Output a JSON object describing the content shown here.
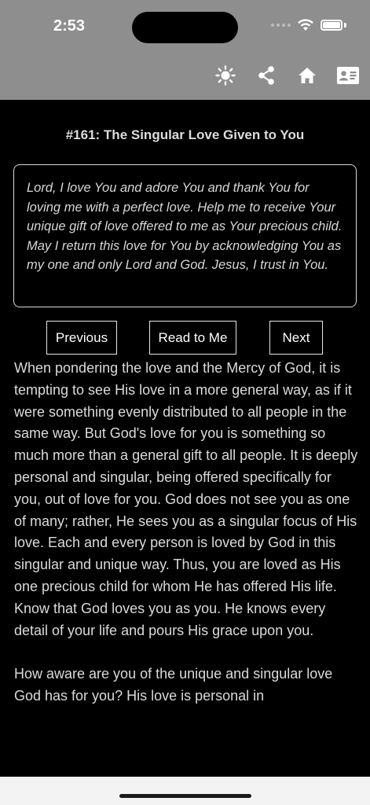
{
  "status": {
    "time": "2:53"
  },
  "toolbar": {
    "icons": [
      "brightness-icon",
      "share-icon",
      "home-icon",
      "contact-card-icon"
    ]
  },
  "reflection": {
    "title": "#161: The Singular Love Given to You",
    "prayer": "Lord, I love You and adore You and thank You for loving me with a perfect love.  Help me to receive Your unique gift of love offered to me as Your precious child.  May I return this love for You by acknowledging You as my one and only Lord and God.  Jesus, I trust in You.",
    "paragraphs": [
      "When pondering the love and the Mercy of God, it is tempting to see His love in a more general way, as if it were something evenly distributed to all people in the same way.  But God's love for you is something so much more than a general gift to all people.  It is deeply personal and singular, being offered specifically for you, out of love for you.  God does not see you as one of many; rather, He sees you as a singular focus of His love.  Each and every person is loved by God in this singular and unique way.  Thus, you are loved as His one precious child for whom He has offered His life.  Know that God loves you as you.  He knows every detail of your life and pours His grace upon you.",
      "How aware are you of the unique and singular love God has for you?  His love is personal in"
    ]
  },
  "buttons": {
    "previous": "Previous",
    "read": "Read to Me",
    "next": "Next"
  }
}
